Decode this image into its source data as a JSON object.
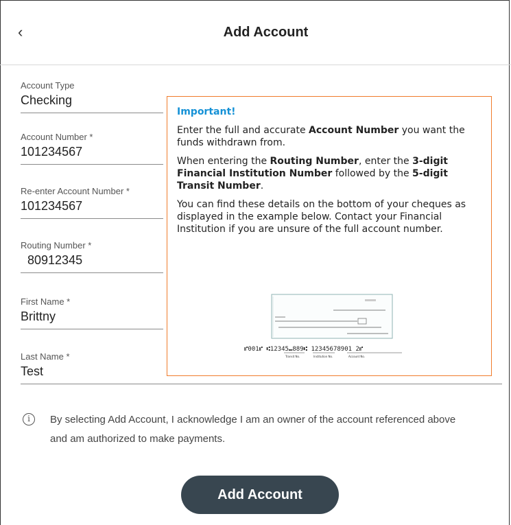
{
  "header": {
    "back_glyph": "‹",
    "title": "Add Account"
  },
  "fields": [
    {
      "label": "Account Type",
      "value": "Checking"
    },
    {
      "label": "Account Number *",
      "value": "101234567"
    },
    {
      "label": "Re-enter Account Number *",
      "value": "101234567"
    },
    {
      "label": "Routing Number *",
      "value": "80912345"
    },
    {
      "label": "First Name *",
      "value": "Brittny"
    },
    {
      "label": "Last Name *",
      "value": "Test"
    }
  ],
  "notice": {
    "heading": "Important!",
    "p1_a": "Enter the full and accurate ",
    "p1_b": "Account Number",
    "p1_c": " you want the funds withdrawn from.",
    "p2_a": "When entering the ",
    "p2_b": "Routing Number",
    "p2_c": ", enter the ",
    "p2_d": "3-digit Financial Institution Number",
    "p2_e": " followed by the ",
    "p2_f": "5-digit Transit Number",
    "p2_g": ".",
    "p3": "You can find these details on the bottom of your cheques as displayed in the example below. Contact your Financial Institution if you are unsure of the full account number.",
    "cheque": {
      "micr": "⑈001⑈ ⑆12345⑉889⑆ 12345678901 2⑈",
      "transit_label": "Transit No.",
      "institution_label": "Institution No.",
      "account_label": "Account No."
    }
  },
  "disclaimer": {
    "icon": "i",
    "text": "By selecting Add Account, I acknowledge I am an owner of the account referenced above and am authorized to make payments."
  },
  "button": {
    "label": "Add Account"
  },
  "colors": {
    "accent_border": "#f07b2a",
    "heading_blue": "#1591d6",
    "button_bg": "#384650"
  }
}
